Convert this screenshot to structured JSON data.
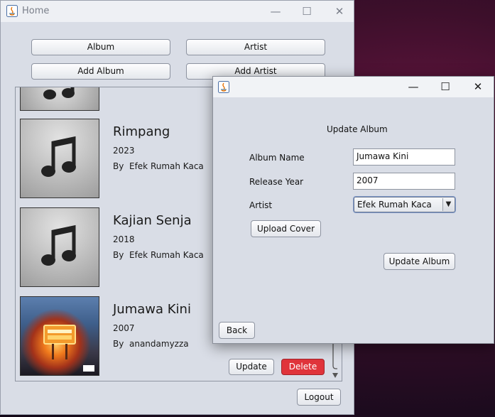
{
  "main_window": {
    "title": "Home",
    "buttons": {
      "album": "Album",
      "artist": "Artist",
      "add_album": "Add Album",
      "add_artist": "Add Artist",
      "update": "Update",
      "delete": "Delete",
      "logout": "Logout"
    },
    "albums": [
      {
        "title": "Rimpang",
        "year": "2023",
        "by_prefix": "By",
        "artist": "Efek Rumah Kaca",
        "cover_icon": "music-note-icon"
      },
      {
        "title": "Kajian Senja",
        "year": "2018",
        "by_prefix": "By",
        "artist": "Efek Rumah Kaca",
        "cover_icon": "music-note-icon"
      },
      {
        "title": "Jumawa Kini",
        "year": "2007",
        "by_prefix": "By",
        "artist": "anandamyzza",
        "cover_icon": "album-art-photo"
      }
    ]
  },
  "dialog": {
    "title": "",
    "heading": "Update Album",
    "fields": {
      "album_name_label": "Album Name",
      "album_name_value": "Jumawa Kini",
      "release_year_label": "Release Year",
      "release_year_value": "2007",
      "artist_label": "Artist",
      "artist_selected": "Efek Rumah Kaca"
    },
    "buttons": {
      "upload_cover": "Upload Cover",
      "update_album": "Update Album",
      "back": "Back"
    }
  },
  "colors": {
    "window_bg": "#d9dde6",
    "delete_button": "#e0343b"
  }
}
